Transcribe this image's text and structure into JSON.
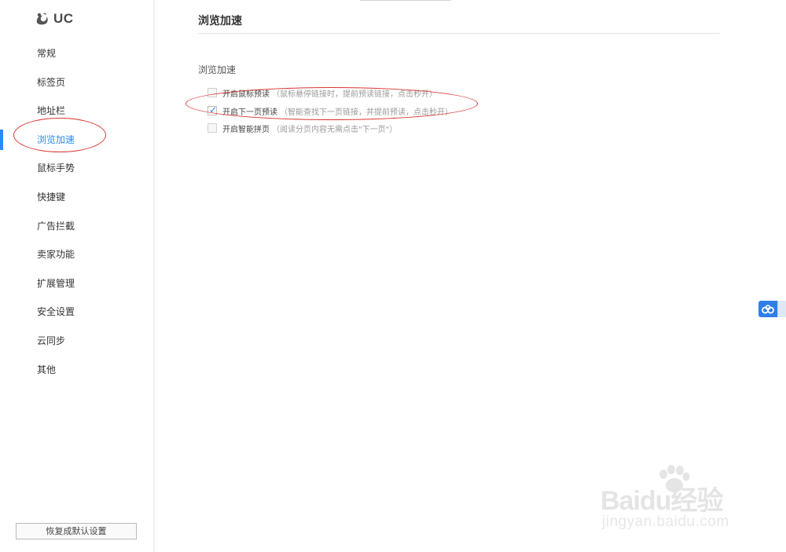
{
  "app": {
    "logo_text": "UC"
  },
  "sidebar": {
    "items": [
      {
        "label": "常规"
      },
      {
        "label": "标签页"
      },
      {
        "label": "地址栏"
      },
      {
        "label": "浏览加速",
        "active": true
      },
      {
        "label": "鼠标手势"
      },
      {
        "label": "快捷键"
      },
      {
        "label": "广告拦截"
      },
      {
        "label": "卖家功能"
      },
      {
        "label": "扩展管理"
      },
      {
        "label": "安全设置"
      },
      {
        "label": "云同步"
      },
      {
        "label": "其他"
      }
    ],
    "restore_button": "恢复成默认设置"
  },
  "main": {
    "title": "浏览加速",
    "section_title": "浏览加速",
    "options": [
      {
        "label": "开启鼠标预读",
        "desc": "（鼠标悬停链接时，提前预读链接，点击秒开）",
        "checked": false
      },
      {
        "label": "开启下一页预读",
        "desc": "（智能查找下一页链接，并提前预读，点击秒开）",
        "checked": true
      },
      {
        "label": "开启智能拼页",
        "desc": "（阅读分页内容无需点击\"下一页\"）",
        "checked": false
      }
    ]
  },
  "watermark": {
    "brand": "Baidu经验",
    "url": "jingyan.baidu.com"
  },
  "colors": {
    "accent": "#2a8cf0",
    "annotation": "#d9362f",
    "widget": "#2f7fe6"
  },
  "icons": {
    "logo": "uc-squirrel-logo-icon",
    "checkmark": "check-icon",
    "float": "baidu-cloud-icon"
  }
}
